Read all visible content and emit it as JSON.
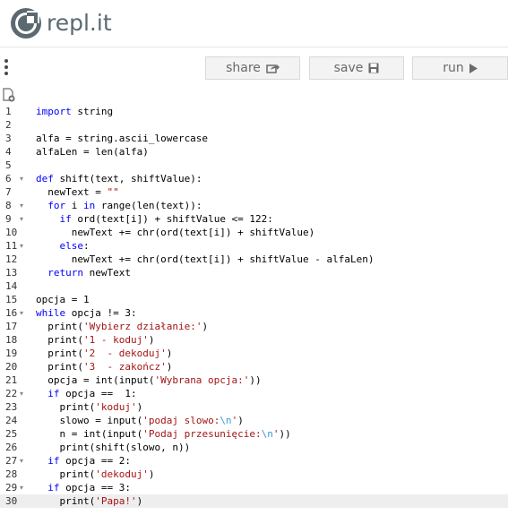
{
  "app": {
    "logo_text": "repl.it"
  },
  "toolbar": {
    "share_label": "share",
    "save_label": "save",
    "run_label": "run"
  },
  "editor": {
    "active_line": 30,
    "lines": [
      {
        "n": "1",
        "fold": false,
        "code": "import string"
      },
      {
        "n": "2",
        "fold": false,
        "code": ""
      },
      {
        "n": "3",
        "fold": false,
        "code": "alfa = string.ascii_lowercase"
      },
      {
        "n": "4",
        "fold": false,
        "code": "alfaLen = len(alfa)"
      },
      {
        "n": "5",
        "fold": false,
        "code": ""
      },
      {
        "n": "6",
        "fold": true,
        "code": "def shift(text, shiftValue):"
      },
      {
        "n": "7",
        "fold": false,
        "code": "  newText = \"\""
      },
      {
        "n": "8",
        "fold": true,
        "code": "  for i in range(len(text)):"
      },
      {
        "n": "9",
        "fold": true,
        "code": "    if ord(text[i]) + shiftValue <= 122:"
      },
      {
        "n": "10",
        "fold": false,
        "code": "      newText += chr(ord(text[i]) + shiftValue)"
      },
      {
        "n": "11",
        "fold": true,
        "code": "    else:"
      },
      {
        "n": "12",
        "fold": false,
        "code": "      newText += chr(ord(text[i]) + shiftValue - alfaLen)"
      },
      {
        "n": "13",
        "fold": false,
        "code": "  return newText"
      },
      {
        "n": "14",
        "fold": false,
        "code": ""
      },
      {
        "n": "15",
        "fold": false,
        "code": "opcja = 1"
      },
      {
        "n": "16",
        "fold": true,
        "code": "while opcja != 3:"
      },
      {
        "n": "17",
        "fold": false,
        "code": "  print('Wybierz działanie:')"
      },
      {
        "n": "18",
        "fold": false,
        "code": "  print('1 - koduj')"
      },
      {
        "n": "19",
        "fold": false,
        "code": "  print('2  - dekoduj')"
      },
      {
        "n": "20",
        "fold": false,
        "code": "  print('3  - zakończ')"
      },
      {
        "n": "21",
        "fold": false,
        "code": "  opcja = int(input('Wybrana opcja:'))"
      },
      {
        "n": "22",
        "fold": true,
        "code": "  if opcja ==  1:"
      },
      {
        "n": "23",
        "fold": false,
        "code": "    print('koduj')"
      },
      {
        "n": "24",
        "fold": false,
        "code": "    slowo = input('podaj slowo:\\n')"
      },
      {
        "n": "25",
        "fold": false,
        "code": "    n = int(input('Podaj przesunięcie:\\n'))"
      },
      {
        "n": "26",
        "fold": false,
        "code": "    print(shift(slowo, n))"
      },
      {
        "n": "27",
        "fold": true,
        "code": "  if opcja == 2:"
      },
      {
        "n": "28",
        "fold": false,
        "code": "    print('dekoduj')"
      },
      {
        "n": "29",
        "fold": true,
        "code": "  if opcja == 3:"
      },
      {
        "n": "30",
        "fold": false,
        "code": "    print('Papa!')"
      }
    ]
  },
  "colors": {
    "keyword": "#0000ff",
    "string": "#a31515",
    "escape": "#3a9ad8",
    "button_bg": "#f3f3f3"
  },
  "icons": {
    "share": "share-icon",
    "save": "floppy-icon",
    "run": "play-icon",
    "menu": "kebab-icon",
    "newfile": "new-file-icon"
  }
}
